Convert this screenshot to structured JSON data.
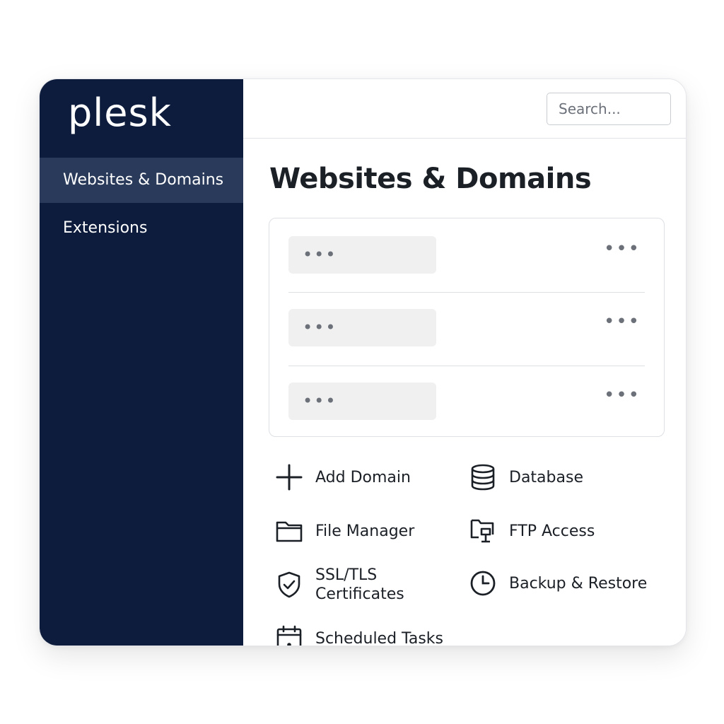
{
  "sidebar": {
    "logo": "plesk",
    "nav": [
      {
        "label": "Websites & Domains",
        "active": true
      },
      {
        "label": "Extensions",
        "active": false
      }
    ]
  },
  "topbar": {
    "search_placeholder": "Search..."
  },
  "main": {
    "title": "Websites & Domains",
    "domains": [
      {
        "name": "•••",
        "menu": "•••"
      },
      {
        "name": "•••",
        "menu": "•••"
      },
      {
        "name": "•••",
        "menu": "•••"
      }
    ],
    "actions": {
      "add_domain": {
        "label": "Add Domain",
        "icon": "plus-icon"
      },
      "database": {
        "label": "Database",
        "icon": "database-icon"
      },
      "file_manager": {
        "label": "File Manager",
        "icon": "folder-icon"
      },
      "ftp_access": {
        "label": "FTP Access",
        "icon": "ftp-icon"
      },
      "ssl": {
        "label": "SSL/TLS Certificates",
        "icon": "shield-check-icon"
      },
      "backup": {
        "label": "Backup & Restore",
        "icon": "clock-icon"
      },
      "scheduled": {
        "label": "Scheduled Tasks",
        "icon": "calendar-icon"
      }
    }
  },
  "colors": {
    "sidebar_bg": "#0d1c3c",
    "sidebar_active": "#2a3a5a",
    "text": "#1b1f26",
    "muted": "#6b7079"
  }
}
